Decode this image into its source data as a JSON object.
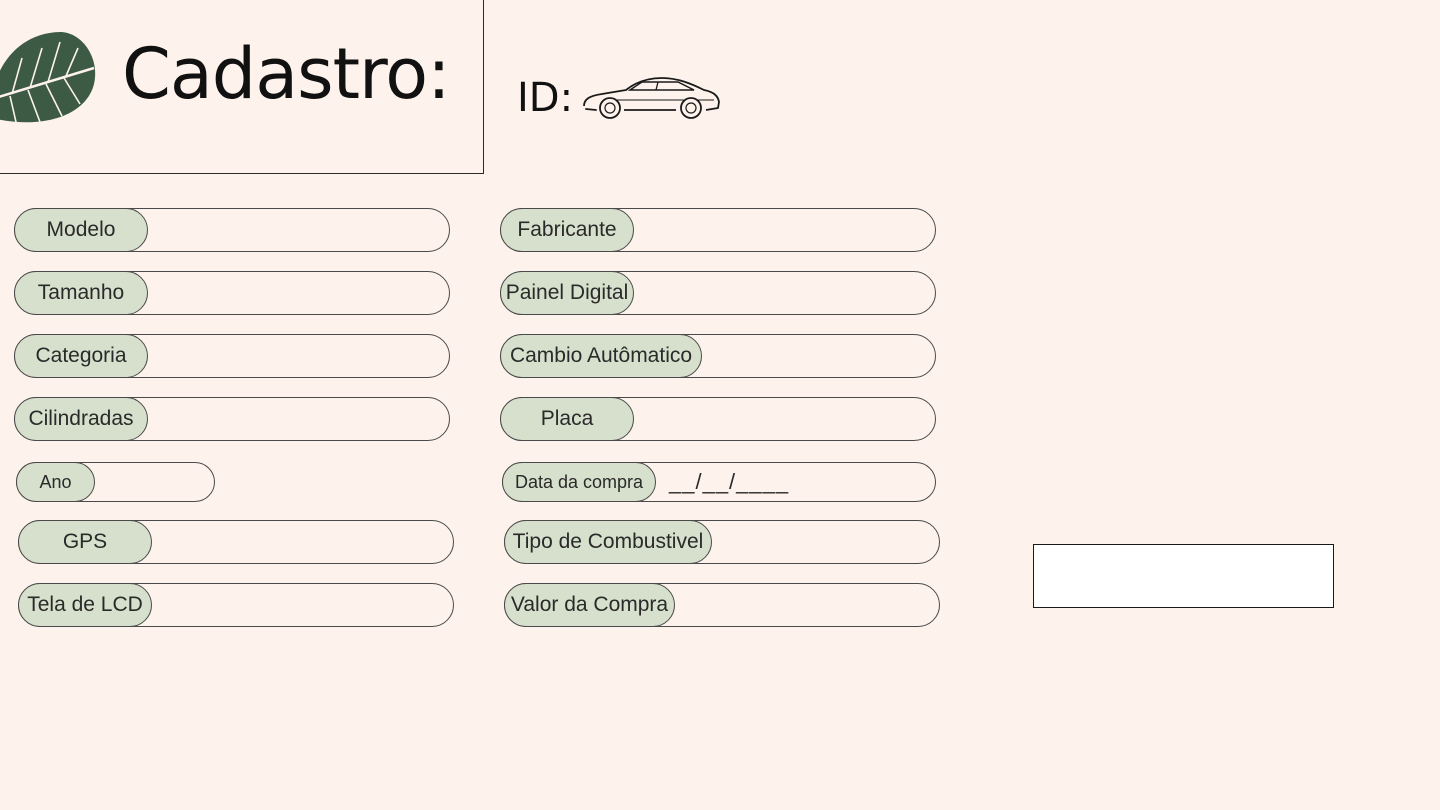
{
  "header": {
    "title": "Cadastro:",
    "id_label": "ID:"
  },
  "icons": {
    "leaf": "leaf-icon",
    "car": "car-icon"
  },
  "colors": {
    "background": "#fdf3ec",
    "pill": "#d6e0cc",
    "leaf": "#3d5a45"
  },
  "form": {
    "left": [
      {
        "label": "Modelo"
      },
      {
        "label": "Tamanho"
      },
      {
        "label": "Categoria"
      },
      {
        "label": "Cilindradas"
      },
      {
        "label": "Ano"
      },
      {
        "label": "GPS"
      },
      {
        "label": "Tela de LCD"
      }
    ],
    "right": [
      {
        "label": "Fabricante"
      },
      {
        "label": "Painel Digital"
      },
      {
        "label": "Cambio Autômatico"
      },
      {
        "label": "Placa"
      },
      {
        "label": "Data da compra",
        "value": "__/__/____"
      },
      {
        "label": "Tipo de Combustivel"
      },
      {
        "label": "Valor da Compra"
      }
    ]
  }
}
